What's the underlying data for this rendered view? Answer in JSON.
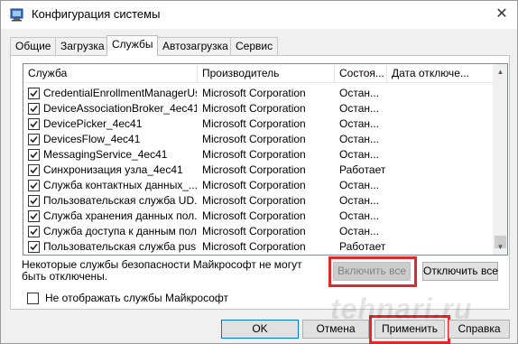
{
  "window": {
    "title": "Конфигурация системы",
    "close": "✕"
  },
  "tabs": [
    {
      "label": "Общие"
    },
    {
      "label": "Загрузка"
    },
    {
      "label": "Службы"
    },
    {
      "label": "Автозагрузка"
    },
    {
      "label": "Сервис"
    }
  ],
  "active_tab": "Службы",
  "columns": [
    "Служба",
    "Производитель",
    "Состоя...",
    "Дата отключе..."
  ],
  "rows": [
    {
      "checked": true,
      "name": "CredentialEnrollmentManagerUs...",
      "vendor": "Microsoft Corporation",
      "status": "Остан..."
    },
    {
      "checked": true,
      "name": "DeviceAssociationBroker_4ec41",
      "vendor": "Microsoft Corporation",
      "status": "Остан..."
    },
    {
      "checked": true,
      "name": "DevicePicker_4ec41",
      "vendor": "Microsoft Corporation",
      "status": "Остан..."
    },
    {
      "checked": true,
      "name": "DevicesFlow_4ec41",
      "vendor": "Microsoft Corporation",
      "status": "Остан..."
    },
    {
      "checked": true,
      "name": "MessagingService_4ec41",
      "vendor": "Microsoft Corporation",
      "status": "Остан..."
    },
    {
      "checked": true,
      "name": "Синхронизация узла_4ec41",
      "vendor": "Microsoft Corporation",
      "status": "Работает"
    },
    {
      "checked": true,
      "name": "Служба контактных данных_...",
      "vendor": "Microsoft Corporation",
      "status": "Остан..."
    },
    {
      "checked": true,
      "name": "Пользовательская служба UD...",
      "vendor": "Microsoft Corporation",
      "status": "Остан..."
    },
    {
      "checked": true,
      "name": "Служба хранения данных пол...",
      "vendor": "Microsoft Corporation",
      "status": "Остан..."
    },
    {
      "checked": true,
      "name": "Служба доступа к данным пол...",
      "vendor": "Microsoft Corporation",
      "status": "Остан..."
    },
    {
      "checked": true,
      "name": "Пользовательская служба pus...",
      "vendor": "Microsoft Corporation",
      "status": "Работает"
    }
  ],
  "note": "Некоторые службы безопасности Майкрософт не могут быть отключены.",
  "buttons": {
    "enable_all": "Включить все",
    "disable_all": "Отключить все",
    "ok": "OK",
    "cancel": "Отмена",
    "apply": "Применить",
    "help": "Справка"
  },
  "hide_ms_label": "Не отображать службы Майкрософт",
  "hide_ms_checked": false,
  "watermark": "tehnari.ru",
  "colors": {
    "highlight": "#e02a2a",
    "focus": "#0078d7"
  }
}
